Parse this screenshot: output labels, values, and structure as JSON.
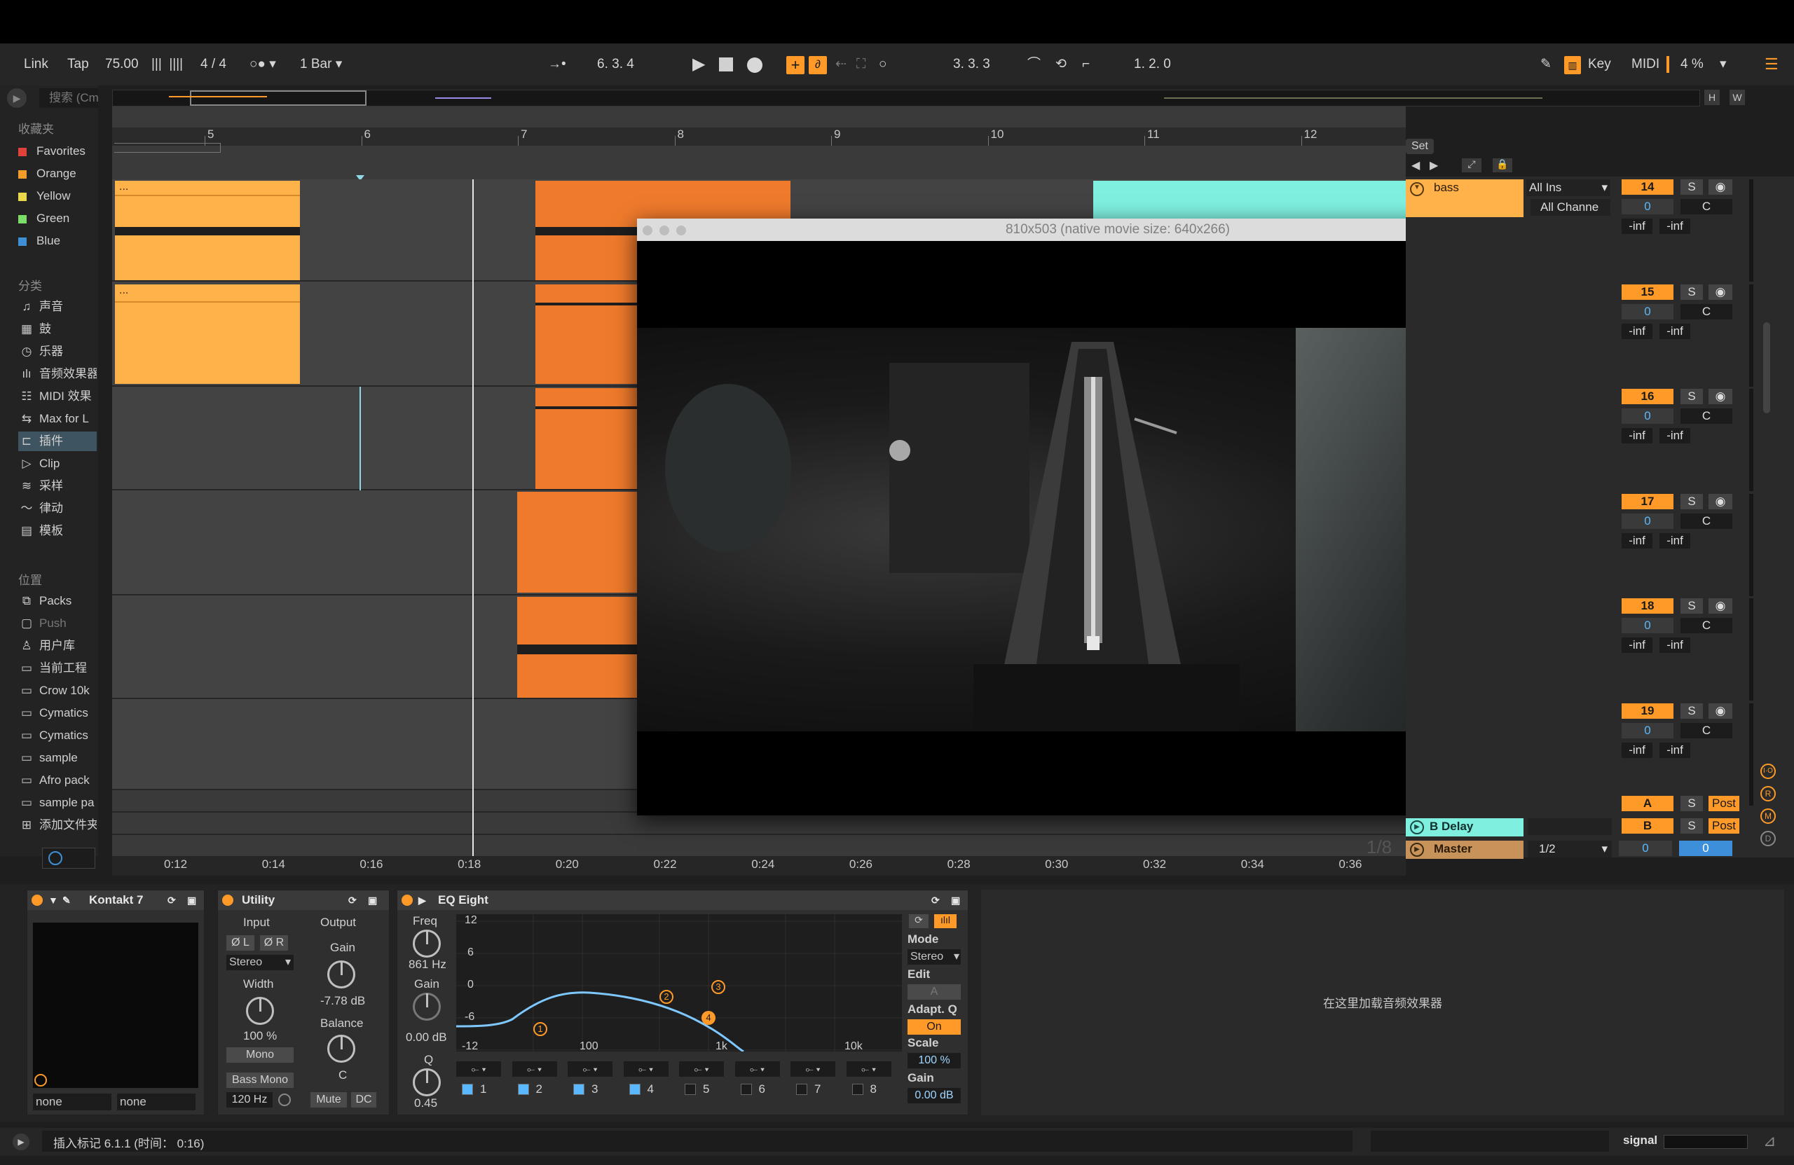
{
  "toolbar": {
    "link": "Link",
    "tap": "Tap",
    "tempo": "75.00",
    "signature": "4 / 4",
    "quantize": "1 Bar",
    "position": "6.   3.   4",
    "loop_start": "3.   3.   3",
    "loop_length": "1.   2.   0",
    "key": "Key",
    "midi": "MIDI",
    "cpu": "4 %"
  },
  "overview": {
    "h": "H",
    "w": "W"
  },
  "sidebar": {
    "search_placeholder": "搜索 (Cm",
    "collections_header": "收藏夹",
    "collections": [
      {
        "label": "Favorites",
        "color": "#e0413a"
      },
      {
        "label": "Orange",
        "color": "#f39c2c"
      },
      {
        "label": "Yellow",
        "color": "#e8d84a"
      },
      {
        "label": "Green",
        "color": "#7bdc6a"
      },
      {
        "label": "Blue",
        "color": "#3f8fd6"
      }
    ],
    "categories_header": "分类",
    "categories": [
      "声音",
      "鼓",
      "乐器",
      "音频效果器",
      "MIDI 效果",
      "Max for L",
      "插件",
      "Clip",
      "采样",
      "律动",
      "模板"
    ],
    "places_header": "位置",
    "places": [
      "Packs",
      "Push",
      "用户库",
      "当前工程",
      "Crow 10k",
      "Cymatics",
      "Cymatics",
      "sample",
      "Afro pack",
      "sample pa",
      "添加文件夹"
    ]
  },
  "arrangement": {
    "bars": [
      "5",
      "6",
      "7",
      "8",
      "9",
      "10",
      "11",
      "12"
    ],
    "set_label": "Set",
    "clip_label": "...",
    "time_labels": [
      "0:12",
      "0:14",
      "0:16",
      "0:18",
      "0:20",
      "0:22",
      "0:24",
      "0:26",
      "0:28",
      "0:30",
      "0:32",
      "0:34",
      "0:36"
    ],
    "loop_indicator": "1/8"
  },
  "video_window": {
    "title": "810x503 (native movie size: 640x266)"
  },
  "mixer": {
    "bass_track": "bass",
    "input_type": "All Ins",
    "input_channel": "All Channe",
    "tracks": [
      {
        "num": "14",
        "vol": "0",
        "pan": "C",
        "l": "-inf",
        "r": "-inf"
      },
      {
        "num": "15",
        "vol": "0",
        "pan": "C",
        "l": "-inf",
        "r": "-inf"
      },
      {
        "num": "16",
        "vol": "0",
        "pan": "C",
        "l": "-inf",
        "r": "-inf"
      },
      {
        "num": "17",
        "vol": "0",
        "pan": "C",
        "l": "-inf",
        "r": "-inf"
      },
      {
        "num": "18",
        "vol": "0",
        "pan": "C",
        "l": "-inf",
        "r": "-inf"
      },
      {
        "num": "19",
        "vol": "0",
        "pan": "C",
        "l": "-inf",
        "r": "-inf"
      }
    ],
    "solo": "S",
    "returns": [
      {
        "name": "",
        "letter": "A",
        "post": "Post"
      },
      {
        "name": "B Delay",
        "letter": "B",
        "post": "Post"
      }
    ],
    "master": {
      "name": "Master",
      "cue": "1/2",
      "vol": "0",
      "vol2": "0"
    }
  },
  "devices": {
    "kontakt": {
      "title": "Kontakt 7",
      "sel1": "none",
      "sel2": "none"
    },
    "utility": {
      "title": "Utility",
      "input": "Input",
      "output": "Output",
      "phase_l": "Ø L",
      "phase_r": "Ø R",
      "channel_mode": "Stereo",
      "gain": "Gain",
      "gain_value": "-7.78 dB",
      "width": "Width",
      "width_value": "100 %",
      "mono": "Mono",
      "balance": "Balance",
      "balance_value": "C",
      "bass_mono": "Bass Mono",
      "bass_freq": "120 Hz",
      "mute": "Mute",
      "dc": "DC"
    },
    "eq": {
      "title": "EQ Eight",
      "freq": "Freq",
      "freq_value": "861 Hz",
      "gain": "Gain",
      "gain_value": "0.00 dB",
      "q": "Q",
      "q_value": "0.45",
      "db_labels": [
        "12",
        "6",
        "0",
        "-6",
        "-12"
      ],
      "freq_labels": [
        "100",
        "1k",
        "10k"
      ],
      "mode": "Mode",
      "mode_value": "Stereo",
      "edit": "Edit",
      "edit_value": "A",
      "adapt_q": "Adapt. Q",
      "adapt_value": "On",
      "scale": "Scale",
      "scale_value": "100 %",
      "out_gain": "Gain",
      "out_gain_value": "0.00 dB",
      "bands": [
        "1",
        "2",
        "3",
        "4",
        "5",
        "6",
        "7",
        "8"
      ],
      "nodes": [
        "1",
        "2",
        "3",
        "4"
      ]
    },
    "drop_hint": "在这里加载音频效果器"
  },
  "status": {
    "message": "插入标记 6.1.1 (时间： 0:16)",
    "signal": "signal"
  }
}
